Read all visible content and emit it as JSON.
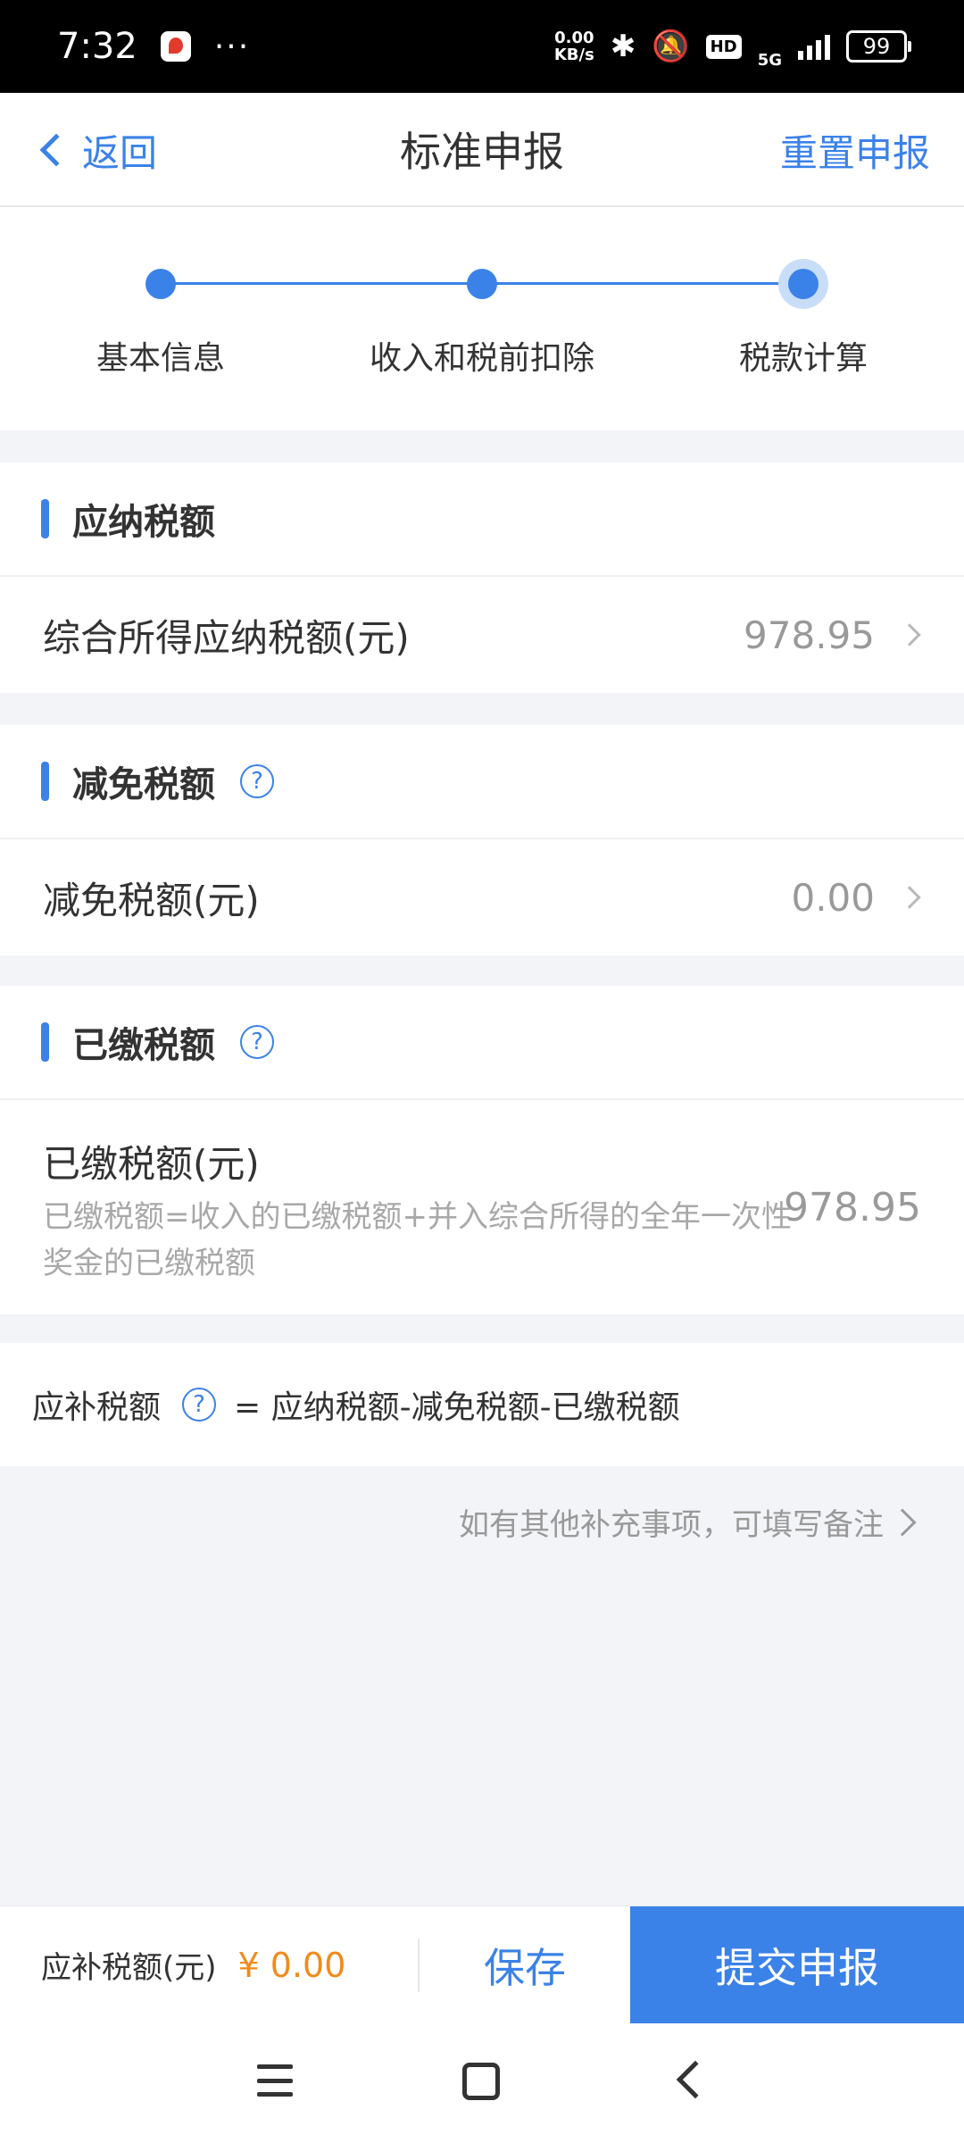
{
  "status_bar": {
    "time": "7:32",
    "dots": "···",
    "net_speed_value": "0.00",
    "net_speed_unit": "KB/s",
    "hd": "HD",
    "network": "5G",
    "battery": "99"
  },
  "header": {
    "back_label": "返回",
    "title": "标准申报",
    "reset_label": "重置申报"
  },
  "stepper": {
    "steps": [
      {
        "label": "基本信息"
      },
      {
        "label": "收入和税前扣除"
      },
      {
        "label": "税款计算"
      }
    ]
  },
  "sections": {
    "payable": {
      "title": "应纳税额",
      "row_label": "综合所得应纳税额(元)",
      "row_value": "978.95"
    },
    "relief": {
      "title": "减免税额",
      "row_label": "减免税额(元)",
      "row_value": "0.00"
    },
    "paid": {
      "title": "已缴税额",
      "row_label": "已缴税额(元)",
      "row_desc": "已缴税额=收入的已缴税额+并入综合所得的全年一次性奖金的已缴税额",
      "row_value": "978.95"
    }
  },
  "formula": {
    "label": "应补税额",
    "equation": "= 应纳税额-减免税额-已缴税额"
  },
  "remark_link": "如有其他补充事项，可填写备注",
  "bottom_bar": {
    "due_label": "应补税额(元)",
    "due_amount": "¥ 0.00",
    "save_label": "保存",
    "submit_label": "提交申报"
  },
  "colors": {
    "accent": "#3b82e8",
    "amount_orange": "#f08a1c"
  }
}
